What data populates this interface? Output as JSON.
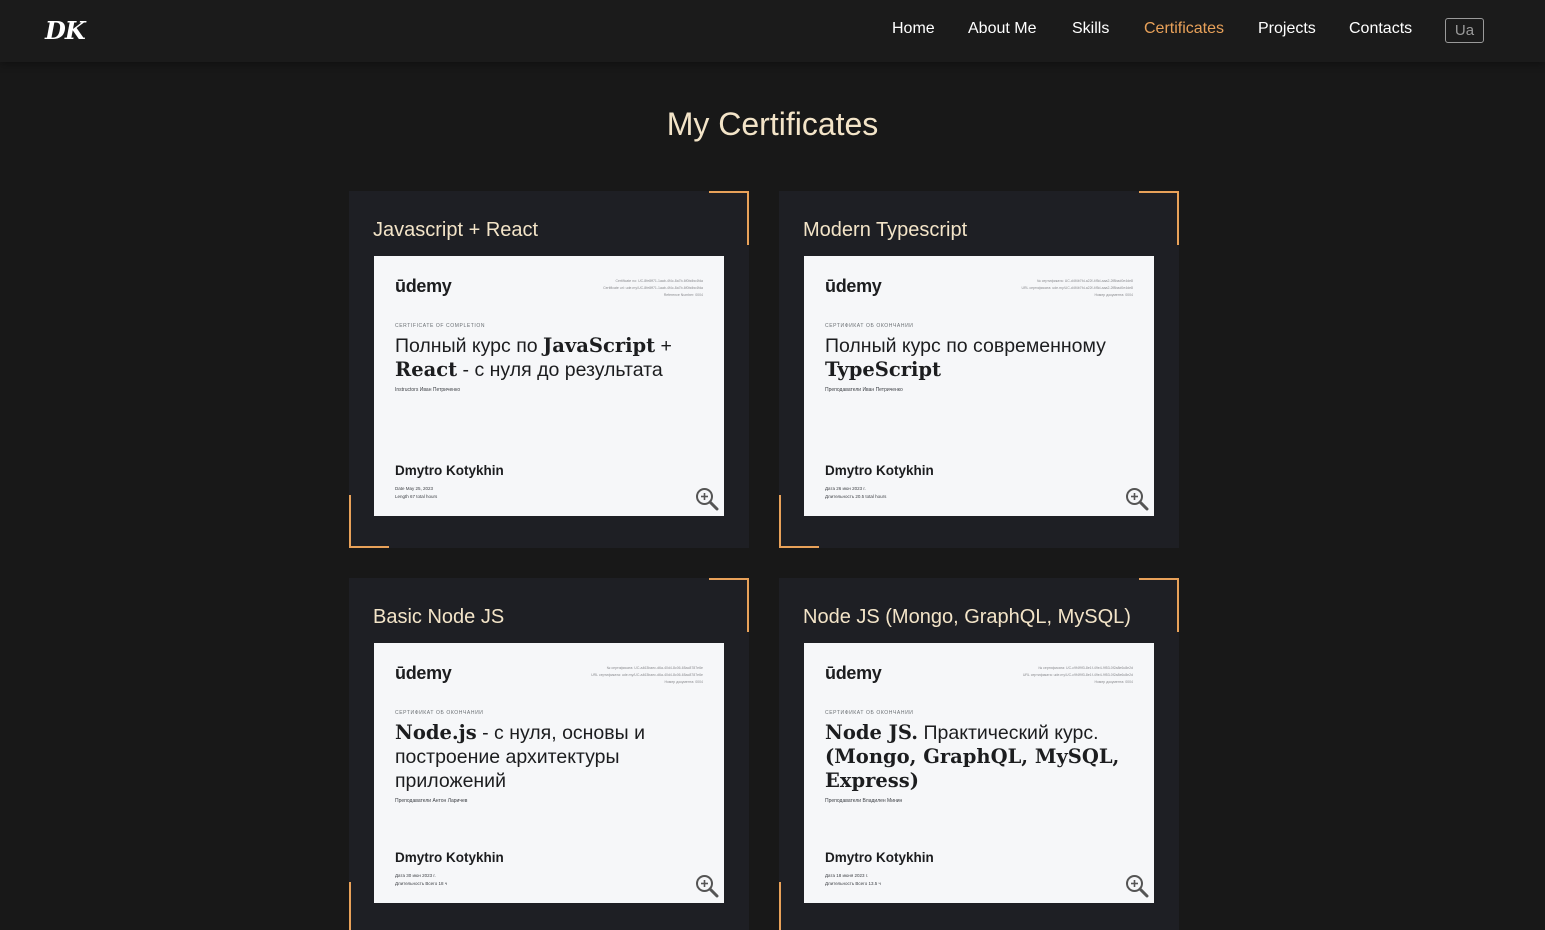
{
  "header": {
    "logo": "DK",
    "nav": [
      {
        "label": "Home",
        "active": false
      },
      {
        "label": "About Me",
        "active": false
      },
      {
        "label": "Skills",
        "active": false
      },
      {
        "label": "Certificates",
        "active": true
      },
      {
        "label": "Projects",
        "active": false
      },
      {
        "label": "Contacts",
        "active": false
      }
    ],
    "lang_button": "Ua"
  },
  "page": {
    "title": "My Certificates"
  },
  "colors": {
    "accent": "#e8a159",
    "title_text": "#f3e4c8",
    "background": "#181818",
    "card_bg": "#1e1f24",
    "udemy_purple": "#a435f0"
  },
  "certificates": [
    {
      "title": "Javascript + React",
      "cert": {
        "brand": "ūdemy",
        "meta": "Certificate no: UC-8fe8ff71-1aab-4f4c-8a7b-6f0bdbc4fda\nCertificate url: ude.my/UC-8fe8ff71-1aab-4f4c-8a7b-6f0bdbc4fda\nReference Number: 0004",
        "kicker": "Certificate of completion",
        "course_bold1": "",
        "course_text1": "Полный курс по ",
        "course_bold2": "JavaScript",
        "course_text2": " + ",
        "course_bold3": "React",
        "course_text3": " - с нуля до результата",
        "instructor": "Instructors  Иван Петриченко",
        "name": "Dmytro Kotykhin",
        "date": "Date   May 25, 2023",
        "length": "Length   67 total hours"
      }
    },
    {
      "title": "Modern Typescript",
      "cert": {
        "brand": "ūdemy",
        "meta": "№ сертификата: UC-d4f4b7fd-a22f-4f5d-aaa2-2f8bad0e4de8\nURL сертификата: ude.my/UC-d4f4b7fd-a22f-4f5d-aaa2-2f8bad0e4de8\nНомер документа: 0004",
        "kicker": "Сертификат об окончании",
        "course_bold1": "",
        "course_text1": "Полный курс по современному ",
        "course_bold2": "TypeScript",
        "course_text2": "",
        "course_bold3": "",
        "course_text3": "",
        "instructor": "Преподаватели  Иван Петриченко",
        "name": "Dmytro Kotykhin",
        "date": "Дата   26 июн 2023 г.",
        "length": "Длительность   20.5 total hours"
      }
    },
    {
      "title": "Basic Node JS",
      "cert": {
        "brand": "ūdemy",
        "meta": "№ сертификата: UC-a463baec-d6a-40d4-8c06-65ac8787e6e\nURL сертификата: ude.my/UC-a463baec-d6a-40d4-8c06-65ac8787e6e\nНомер документа: 0004",
        "kicker": "Сертификат об окончании",
        "course_bold1": "Node.js",
        "course_text1": " - с нуля, основы и построение архитектуры приложений",
        "course_bold2": "",
        "course_text2": "",
        "course_bold3": "",
        "course_text3": "",
        "instructor": "Преподаватели  Антон Ларичев",
        "name": "Dmytro Kotykhin",
        "date": "Дата   30 июн 2023 г.",
        "length": "Длительность   Всего 18 ч"
      }
    },
    {
      "title": "Node JS (Mongo, GraphQL, MySQL)",
      "cert": {
        "brand": "ūdemy",
        "meta": "№ сертификата: UC-c9f4f9f3-8e1f-49e4-9f53-0f2a8e6c8e2d\nURL сертификата: ude.my/UC-c9f4f9f3-8e1f-49e4-9f53-0f2a8e6c8e2d\nНомер документа: 0004",
        "kicker": "Сертификат об окончании",
        "course_bold1": "Node JS.",
        "course_text1": " Практический курс. ",
        "course_bold2": "(Mongo, GraphQL, MySQL, Express)",
        "course_text2": "",
        "course_bold3": "",
        "course_text3": "",
        "instructor": "Преподаватели  Владилен Минин",
        "name": "Dmytro Kotykhin",
        "date": "Дата   18 июня 2023 г.",
        "length": "Длительность   Всего 13.5 ч"
      }
    }
  ]
}
